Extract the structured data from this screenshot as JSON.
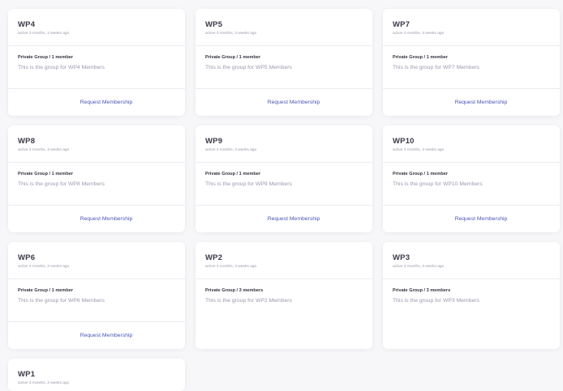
{
  "groups": [
    {
      "name": "WP4",
      "active": "active 3 months, 3 weeks ago",
      "meta": "Private Group / 1 member",
      "description": "This is the group for WP4 Members",
      "action": "Request Membership"
    },
    {
      "name": "WP5",
      "active": "active 3 months, 3 weeks ago",
      "meta": "Private Group / 1 member",
      "description": "This is the group for WP5 Members",
      "action": "Request Membership"
    },
    {
      "name": "WP7",
      "active": "active 3 months, 3 weeks ago",
      "meta": "Private Group / 1 member",
      "description": "This is the group for WP7 Members",
      "action": "Request Membership"
    },
    {
      "name": "WP8",
      "active": "active 3 months, 3 weeks ago",
      "meta": "Private Group / 1 member",
      "description": "This is the group for WP8 Members",
      "action": "Request Membership"
    },
    {
      "name": "WP9",
      "active": "active 3 months, 3 weeks ago",
      "meta": "Private Group / 1 member",
      "description": "This is the group for WP9 Members",
      "action": "Request Membership"
    },
    {
      "name": "WP10",
      "active": "active 3 months, 3 weeks ago",
      "meta": "Private Group / 1 member",
      "description": "This is the group for WP10 Members",
      "action": "Request Membership"
    },
    {
      "name": "WP6",
      "active": "active 3 months, 3 weeks ago",
      "meta": "Private Group / 1 member",
      "description": "This is the group for WP6 Members",
      "action": "Request Membership"
    },
    {
      "name": "WP2",
      "active": "active 3 months, 3 weeks ago",
      "meta": "Private Group / 3 members",
      "description": "This is the group for WP2 Members"
    },
    {
      "name": "WP3",
      "active": "active 3 months, 3 weeks ago",
      "meta": "Private Group / 3 members",
      "description": "This is the group for WP3 Members"
    },
    {
      "name": "WP1",
      "active": "active 3 months, 3 weeks ago"
    }
  ]
}
